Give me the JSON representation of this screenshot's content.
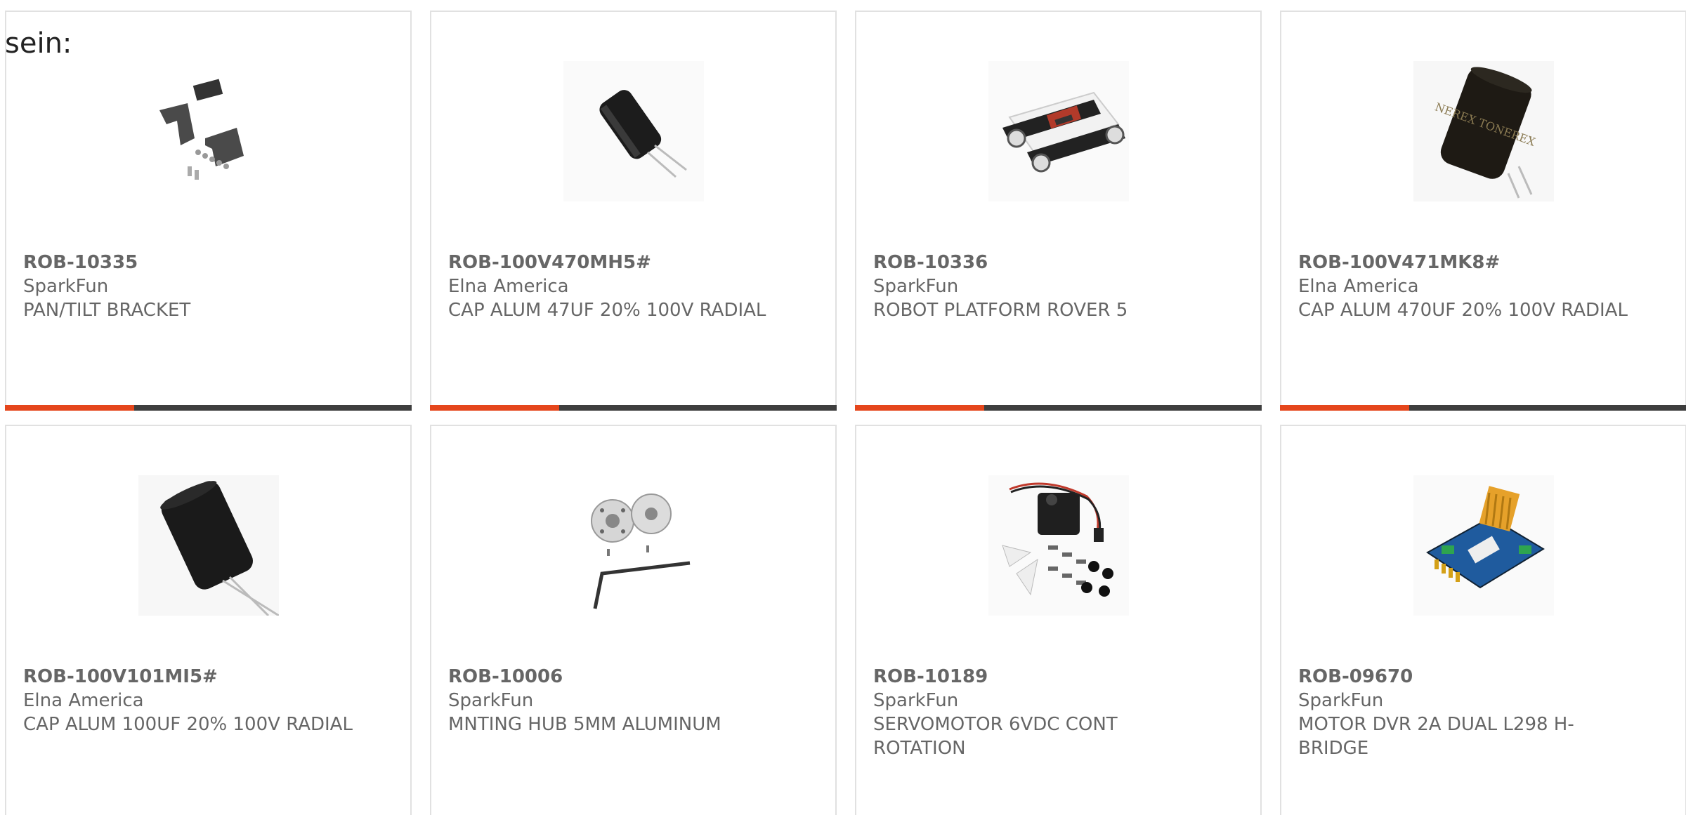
{
  "intro_text": "sein:",
  "colors": {
    "accent": "#e5461c",
    "bar": "#3e3e3e",
    "border": "#e1e1e1",
    "text": "#666666"
  },
  "products": [
    {
      "sku": "ROB-10335",
      "maker": "SparkFun",
      "desc": "PAN/TILT BRACKET",
      "image": "pan-tilt-bracket-image"
    },
    {
      "sku": "ROB-100V470MH5#",
      "maker": "Elna America",
      "desc": "CAP ALUM 47UF 20% 100V RADIAL",
      "image": "capacitor-image"
    },
    {
      "sku": "ROB-10336",
      "maker": "SparkFun",
      "desc": "ROBOT PLATFORM ROVER 5",
      "image": "robot-platform-image"
    },
    {
      "sku": "ROB-100V471MK8#",
      "maker": "Elna America",
      "desc": "CAP ALUM 470UF 20% 100V RADIAL",
      "image": "capacitor-image"
    },
    {
      "sku": "ROB-100V101MI5#",
      "maker": "Elna America",
      "desc": "CAP ALUM 100UF 20% 100V RADIAL",
      "image": "capacitor-image"
    },
    {
      "sku": "ROB-10006",
      "maker": "SparkFun",
      "desc": "MNTING HUB 5MM ALUMINUM",
      "image": "mounting-hub-image"
    },
    {
      "sku": "ROB-10189",
      "maker": "SparkFun",
      "desc": "SERVOMOTOR 6VDC CONT ROTATION",
      "image": "servomotor-image"
    },
    {
      "sku": "ROB-09670",
      "maker": "SparkFun",
      "desc": "MOTOR DVR 2A DUAL L298 H-BRIDGE",
      "image": "motor-driver-image"
    }
  ]
}
